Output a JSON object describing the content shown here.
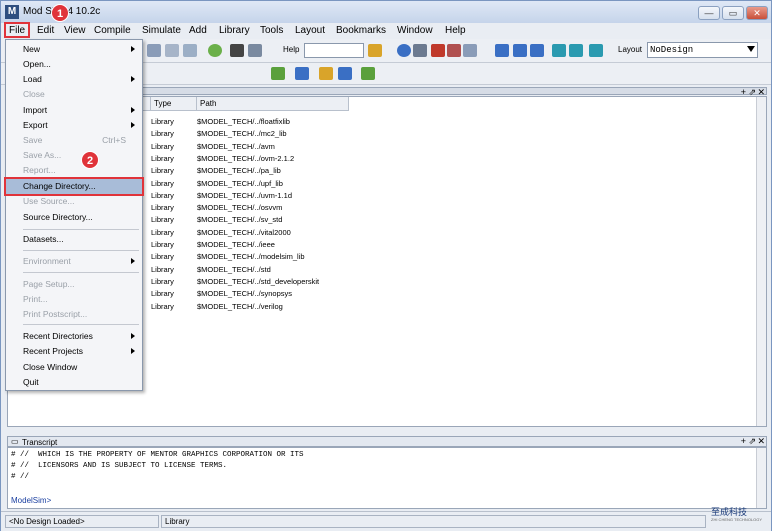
{
  "window": {
    "title": "Mod  SE-64 10.2c",
    "app_icon": "M"
  },
  "window_controls": {
    "minimize": "—",
    "maximize": "▭",
    "close": "✕"
  },
  "menubar": [
    "File",
    "Edit",
    "View",
    "Compile",
    "Simulate",
    "Add",
    "Library",
    "Tools",
    "Layout",
    "Bookmarks",
    "Window",
    "Help"
  ],
  "toolbar": {
    "help_label": "Help",
    "layout_label": "Layout",
    "layout_value": "NoDesign"
  },
  "file_menu": [
    {
      "label": "New",
      "arrow": true,
      "disabled": false
    },
    {
      "label": "Open...",
      "disabled": false
    },
    {
      "label": "Load",
      "arrow": true,
      "disabled": false
    },
    {
      "label": "Close",
      "disabled": true
    },
    {
      "label": "Import",
      "arrow": true,
      "disabled": false
    },
    {
      "label": "Export",
      "arrow": true,
      "disabled": false
    },
    {
      "label": "Save",
      "shortcut": "Ctrl+S",
      "disabled": true
    },
    {
      "label": "Save As...",
      "disabled": true
    },
    {
      "label": "Report...",
      "disabled": true
    },
    {
      "label": "Change Directory...",
      "disabled": false,
      "highlighted": true
    },
    {
      "label": "Use Source...",
      "disabled": true
    },
    {
      "label": "Source Directory...",
      "disabled": false
    },
    {
      "label": "Datasets...",
      "disabled": false
    },
    {
      "label": "Environment",
      "arrow": true,
      "disabled": true
    },
    {
      "label": "Page Setup...",
      "disabled": true
    },
    {
      "label": "Print...",
      "disabled": true
    },
    {
      "label": "Print Postscript...",
      "disabled": true
    },
    {
      "label": "Recent Directories",
      "arrow": true,
      "disabled": false
    },
    {
      "label": "Recent Projects",
      "arrow": true,
      "disabled": false
    },
    {
      "label": "Close Window",
      "disabled": false
    },
    {
      "label": "Quit",
      "disabled": false
    }
  ],
  "badges": {
    "one": "1",
    "two": "2"
  },
  "library": {
    "columns": [
      "Type",
      "Path"
    ],
    "rows": [
      {
        "type": "Library",
        "path": "$MODEL_TECH/../floatfixlib"
      },
      {
        "type": "Library",
        "path": "$MODEL_TECH/../mc2_lib"
      },
      {
        "type": "Library",
        "path": "$MODEL_TECH/../avm"
      },
      {
        "type": "Library",
        "path": "$MODEL_TECH/../ovm-2.1.2"
      },
      {
        "type": "Library",
        "path": "$MODEL_TECH/../pa_lib"
      },
      {
        "type": "Library",
        "path": "$MODEL_TECH/../upf_lib"
      },
      {
        "type": "Library",
        "path": "$MODEL_TECH/../uvm-1.1d"
      },
      {
        "type": "Library",
        "path": "$MODEL_TECH/../osvvm"
      },
      {
        "type": "Library",
        "path": "$MODEL_TECH/../sv_std"
      },
      {
        "type": "Library",
        "path": "$MODEL_TECH/../vital2000"
      },
      {
        "type": "Library",
        "path": "$MODEL_TECH/../ieee"
      },
      {
        "type": "Library",
        "path": "$MODEL_TECH/../modelsim_lib"
      },
      {
        "type": "Library",
        "path": "$MODEL_TECH/../std"
      },
      {
        "type": "Library",
        "path": "$MODEL_TECH/../std_developerskit"
      },
      {
        "type": "Library",
        "path": "$MODEL_TECH/../synopsys"
      },
      {
        "type": "Library",
        "path": "$MODEL_TECH/../verilog"
      }
    ]
  },
  "transcript": {
    "title": "Transcript",
    "lines": [
      "# //  WHICH IS THE PROPERTY OF MENTOR GRAPHICS CORPORATION OR ITS",
      "# //  LICENSORS AND IS SUBJECT TO LICENSE TERMS.",
      "# //"
    ],
    "prompt": "ModelSim>"
  },
  "pane_controls": {
    "add": "+",
    "undock": "⇗",
    "close": "✕"
  },
  "status": {
    "design": "<No Design Loaded>",
    "context": "Library"
  },
  "logo": {
    "name": "至成科技",
    "tagline": "ZHI CHENG TECHNOLOGY"
  },
  "icon_colors": [
    "#3a6fc4",
    "#d9a42a",
    "#5aa03c",
    "#c0392b",
    "#7a5cb0",
    "#2a9ab0"
  ]
}
